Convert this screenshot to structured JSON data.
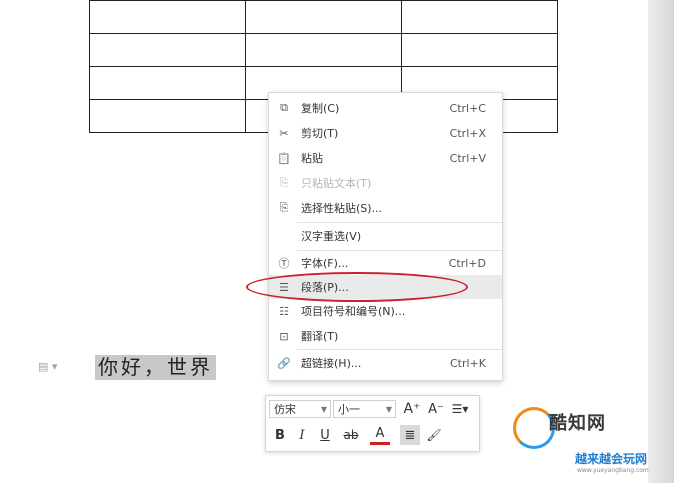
{
  "context_menu": {
    "items": [
      {
        "icon": "copy-icon",
        "label": "复制(C)",
        "shortcut": "Ctrl+C"
      },
      {
        "icon": "cut-icon",
        "label": "剪切(T)",
        "shortcut": "Ctrl+X"
      },
      {
        "icon": "paste-icon",
        "label": "粘贴",
        "shortcut": "Ctrl+V"
      },
      {
        "icon": "paste-text-icon",
        "label": "只粘贴文本(T)",
        "shortcut": "",
        "disabled": true
      },
      {
        "icon": "paste-special-icon",
        "label": "选择性粘贴(S)...",
        "shortcut": ""
      },
      {
        "icon": "",
        "label": "汉字重选(V)",
        "shortcut": ""
      },
      {
        "icon": "font-icon",
        "label": "字体(F)...",
        "shortcut": "Ctrl+D"
      },
      {
        "icon": "paragraph-icon",
        "label": "段落(P)...",
        "shortcut": "",
        "highlighted": true
      },
      {
        "icon": "bullets-icon",
        "label": "项目符号和编号(N)...",
        "shortcut": ""
      },
      {
        "icon": "translate-icon",
        "label": "翻译(T)",
        "shortcut": ""
      },
      {
        "icon": "link-icon",
        "label": "超链接(H)...",
        "shortcut": "Ctrl+K"
      }
    ]
  },
  "document": {
    "selected_text": "你好，世界"
  },
  "mini_toolbar": {
    "font_name": "仿宋",
    "font_size": "小一",
    "grow_font": "A⁺",
    "shrink_font": "A⁻",
    "bold": "B",
    "italic": "I",
    "underline": "U",
    "strike": "ab",
    "font_color": "A"
  },
  "watermark": {
    "title": "酷知网",
    "subtitle": "越来越会玩网",
    "url": "www.yueyangbang.com"
  },
  "colors": {
    "annotation_red": "#c8232c",
    "highlight_bg": "#eaeaea",
    "selection_bg": "#c8c8c8"
  }
}
